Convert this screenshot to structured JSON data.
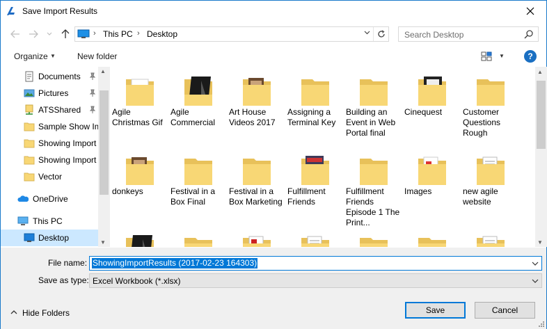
{
  "window": {
    "title": "Save Import Results"
  },
  "address": {
    "crumbs": [
      "This PC",
      "Desktop"
    ],
    "separator": "›"
  },
  "search": {
    "placeholder": "Search Desktop"
  },
  "toolbar": {
    "organize": "Organize",
    "new_folder": "New folder",
    "help": "?"
  },
  "nav": {
    "items": [
      {
        "label": "Documents",
        "icon": "documents-icon",
        "pinned": true
      },
      {
        "label": "Pictures",
        "icon": "pictures-icon",
        "pinned": true
      },
      {
        "label": "ATSShared",
        "icon": "network-folder-icon",
        "pinned": true
      },
      {
        "label": "Sample Show Im",
        "icon": "folder-icon",
        "pinned": false
      },
      {
        "label": "Showing Import",
        "icon": "folder-icon",
        "pinned": false
      },
      {
        "label": "Showing Import",
        "icon": "folder-icon",
        "pinned": false
      },
      {
        "label": "Vector",
        "icon": "folder-icon",
        "pinned": false
      },
      {
        "label": "OneDrive",
        "icon": "onedrive-icon",
        "pinned": false
      },
      {
        "label": "This PC",
        "icon": "this-pc-icon",
        "pinned": false
      },
      {
        "label": "Desktop",
        "icon": "desktop-icon",
        "pinned": false,
        "selected": true
      }
    ]
  },
  "files": [
    {
      "name": "Agile Christmas Gif",
      "thumb": "edge-doc"
    },
    {
      "name": "Agile Commercial",
      "thumb": "dark-doc"
    },
    {
      "name": "Art House Videos 2017",
      "thumb": "photo-folder"
    },
    {
      "name": "Assigning a Terminal Key",
      "thumb": "plain-folder"
    },
    {
      "name": "Building an Event in Web Portal final",
      "thumb": "plain-folder"
    },
    {
      "name": "Cinequest",
      "thumb": "film-folder"
    },
    {
      "name": "Customer Questions Rough",
      "thumb": "plain-folder"
    },
    {
      "name": "donkeys",
      "thumb": "photo-folder"
    },
    {
      "name": "Festival in a Box Final",
      "thumb": "plain-folder"
    },
    {
      "name": "Festival in a Box Marketing",
      "thumb": "plain-folder"
    },
    {
      "name": "Fulfillment Friends",
      "thumb": "poster-folder"
    },
    {
      "name": "Fulfillment Friends Episode 1 The Print...",
      "thumb": "plain-folder"
    },
    {
      "name": "Images",
      "thumb": "image-folder"
    },
    {
      "name": "new agile website",
      "thumb": "doc-folder"
    },
    {
      "name": "",
      "thumb": "dark-doc"
    },
    {
      "name": "",
      "thumb": "plain-folder"
    },
    {
      "name": "",
      "thumb": "red-folder"
    },
    {
      "name": "",
      "thumb": "doc-folder"
    },
    {
      "name": "",
      "thumb": "plain-folder"
    },
    {
      "name": "",
      "thumb": "plain-folder"
    },
    {
      "name": "",
      "thumb": "doc-folder"
    }
  ],
  "form": {
    "file_name_label": "File name:",
    "file_name_value": "ShowingImportResults (2017-02-23 164303)",
    "save_type_label": "Save as type:",
    "save_type_value": "Excel Workbook (*.xlsx)"
  },
  "footer": {
    "hide_folders": "Hide Folders",
    "save": "Save",
    "cancel": "Cancel"
  },
  "colors": {
    "accent": "#0078d7",
    "folder": "#f8d775",
    "selected_bg": "#cce8ff"
  }
}
